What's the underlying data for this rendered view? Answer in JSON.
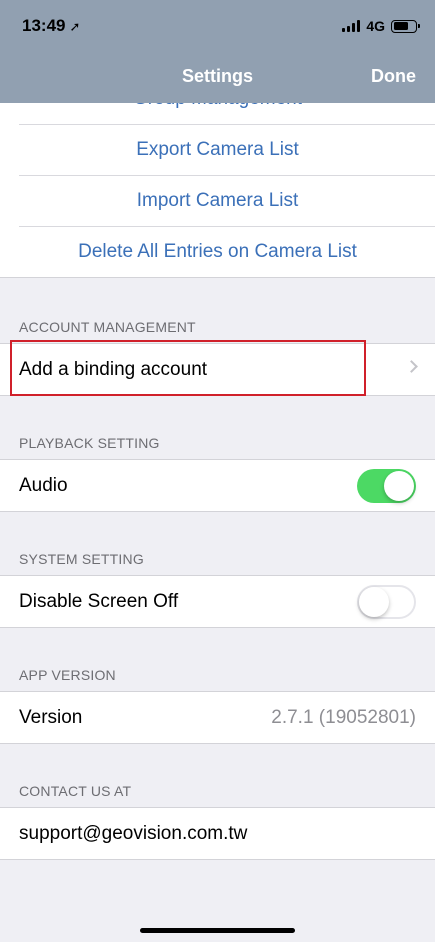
{
  "status_bar": {
    "time": "13:49",
    "location_icon": "location-arrow-icon",
    "network": "4G"
  },
  "nav": {
    "title": "Settings",
    "done_label": "Done"
  },
  "camera_list": {
    "items": [
      {
        "label": "Group Management"
      },
      {
        "label": "Export Camera List"
      },
      {
        "label": "Import Camera List"
      },
      {
        "label": "Delete All Entries on Camera List"
      }
    ]
  },
  "account": {
    "header": "ACCOUNT MANAGEMENT",
    "binding_label": "Add a binding account"
  },
  "playback": {
    "header": "PLAYBACK SETTING",
    "audio_label": "Audio",
    "audio_on": true
  },
  "system": {
    "header": "SYSTEM SETTING",
    "screen_off_label": "Disable Screen Off",
    "screen_off_on": false
  },
  "app_version": {
    "header": "APP VERSION",
    "label": "Version",
    "value": "2.7.1  (19052801)"
  },
  "contact": {
    "header": "CONTACT US AT",
    "email": "support@geovision.com.tw"
  },
  "colors": {
    "accent_link": "#3b70b8",
    "header_bg": "#91a0b1",
    "toggle_on": "#4cd964",
    "highlight": "#d0202a"
  }
}
